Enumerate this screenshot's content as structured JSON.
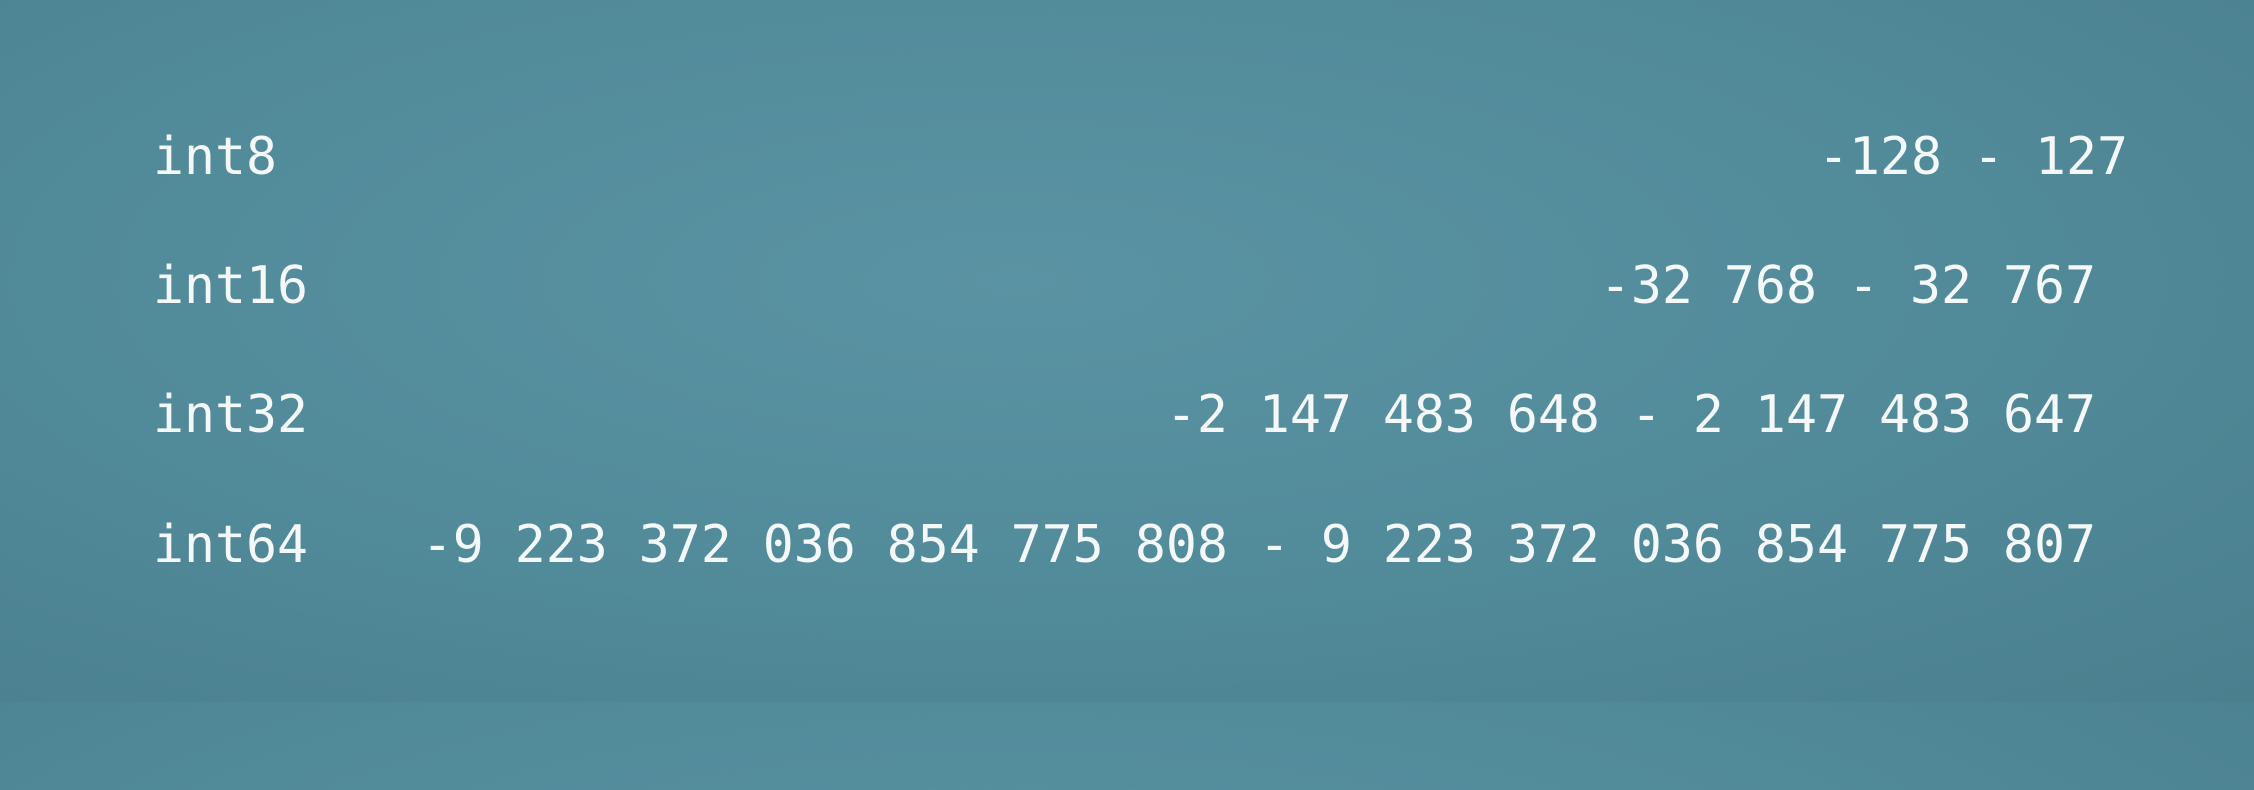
{
  "table": {
    "rows": [
      {
        "type": "int8",
        "range": "-128 - 127"
      },
      {
        "type": "int16",
        "range": "-32 768 - 32 767"
      },
      {
        "type": "int32",
        "range": "-2 147 483 648 - 2 147 483 647"
      },
      {
        "type": "int64",
        "range": "-9 223 372 036 854 775 808 - 9 223 372 036 854 775 807"
      }
    ]
  },
  "colors": {
    "background": "#518a99",
    "text": "#f4f8f9"
  }
}
